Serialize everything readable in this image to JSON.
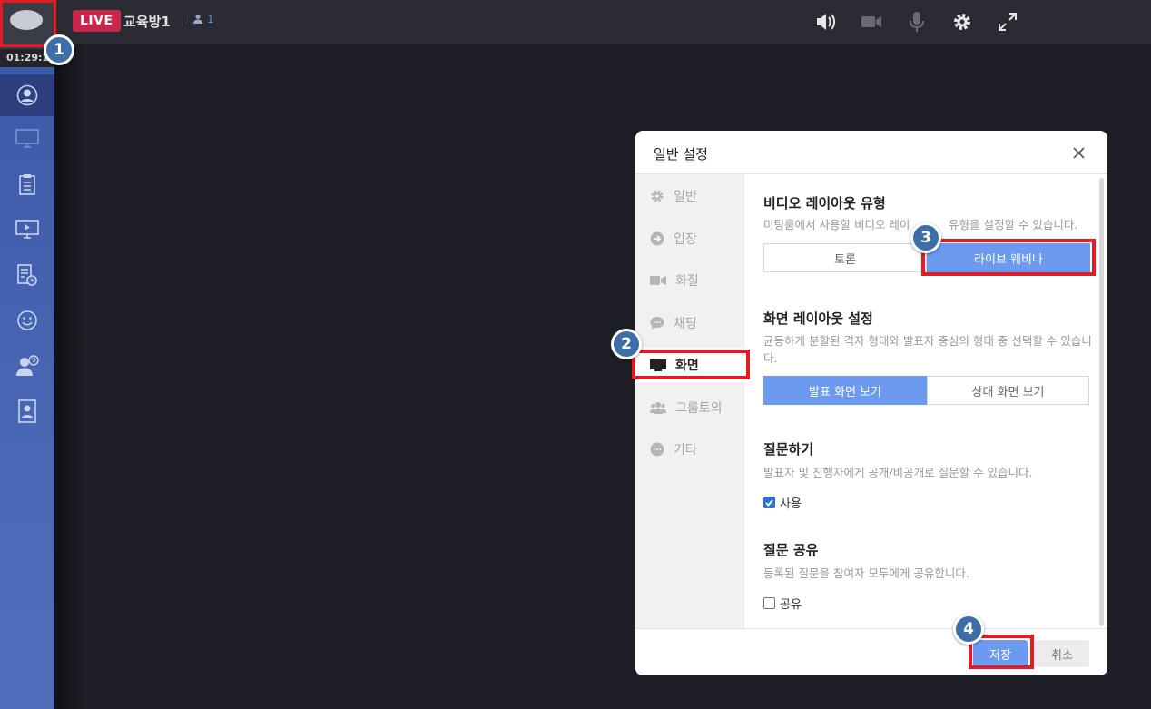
{
  "header": {
    "live_badge": "LIVE",
    "room_title": "교육방1",
    "participant_count": "1",
    "icons": [
      "speaker-icon",
      "camera-icon",
      "microphone-icon",
      "gear-icon",
      "fullscreen-icon"
    ]
  },
  "sidebar": {
    "timer": "01:29:1",
    "items": [
      "user-circle-icon",
      "monitor-icon",
      "clipboard-icon",
      "video-icon",
      "report-icon",
      "smile-icon",
      "user-question-icon",
      "contact-icon"
    ]
  },
  "callouts": [
    "1",
    "2",
    "3",
    "4"
  ],
  "modal": {
    "title": "일반 설정",
    "nav": [
      {
        "label": "일반",
        "icon": "gear-icon"
      },
      {
        "label": "입장",
        "icon": "enter-icon"
      },
      {
        "label": "화질",
        "icon": "video-icon"
      },
      {
        "label": "채팅",
        "icon": "chat-icon"
      },
      {
        "label": "화면",
        "icon": "monitor-icon",
        "active": true
      },
      {
        "label": "그룹토의",
        "icon": "group-icon"
      },
      {
        "label": "기타",
        "icon": "more-icon"
      }
    ],
    "sections": {
      "video_layout": {
        "title": "비디오 레이아웃 유형",
        "desc_a": "미팅룸에서 사용할 비디오 레이",
        "desc_b": "유형을 설정할 수 있습니다.",
        "options": [
          "토론",
          "라이브 웨비나"
        ],
        "selected": 1
      },
      "screen_layout": {
        "title": "화면 레이아웃 설정",
        "desc": "균등하게 분할된 격자 형태와 발표자 중심의 형태 중 선택할 수 있습니다.",
        "options": [
          "발표 화면 보기",
          "상대 화면 보기"
        ],
        "selected": 0
      },
      "questions": {
        "title": "질문하기",
        "desc": "발표자 및 진행자에게 공개/비공개로 질문할 수 있습니다.",
        "checkbox_label": "사용",
        "checked": true
      },
      "question_share": {
        "title": "질문 공유",
        "desc": "등록된 질문을 참여자 모두에게 공유합니다.",
        "checkbox_label": "공유",
        "checked": false
      }
    },
    "footer": {
      "save": "저장",
      "cancel": "취소"
    }
  },
  "colors": {
    "accent": "#6b9af0",
    "live": "#c8264a",
    "highlight": "#e31b23",
    "callout": "#3e6ea8",
    "sidebar": "#4968b6"
  }
}
